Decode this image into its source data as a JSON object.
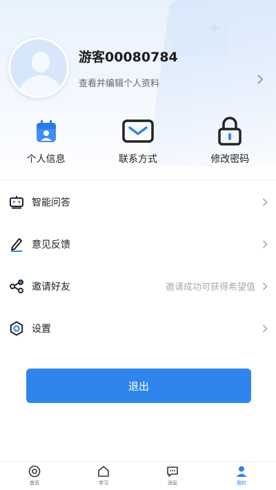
{
  "profile": {
    "username": "游客00080784",
    "edit_label": "查看并编辑个人资料"
  },
  "quick_actions": [
    {
      "label": "个人信息",
      "icon": "calendar-person-icon"
    },
    {
      "label": "联系方式",
      "icon": "mail-icon"
    },
    {
      "label": "修改密码",
      "icon": "lock-icon"
    }
  ],
  "menu": [
    {
      "label": "智能问答",
      "icon": "robot-icon",
      "hint": ""
    },
    {
      "label": "意见反馈",
      "icon": "pen-icon",
      "hint": ""
    },
    {
      "label": "邀请好友",
      "icon": "share-icon",
      "hint": "邀请成功可获得希望值"
    },
    {
      "label": "设置",
      "icon": "gear-icon",
      "hint": ""
    }
  ],
  "logout_label": "退出",
  "tabs": [
    {
      "label": "首页",
      "icon": "target-icon",
      "active": false
    },
    {
      "label": "学习",
      "icon": "home-icon",
      "active": false
    },
    {
      "label": "消息",
      "icon": "message-icon",
      "active": false
    },
    {
      "label": "我的",
      "icon": "user-icon",
      "active": true
    }
  ],
  "colors": {
    "accent": "#2f85ec",
    "text": "#222222",
    "hint": "#aaaaaa"
  }
}
